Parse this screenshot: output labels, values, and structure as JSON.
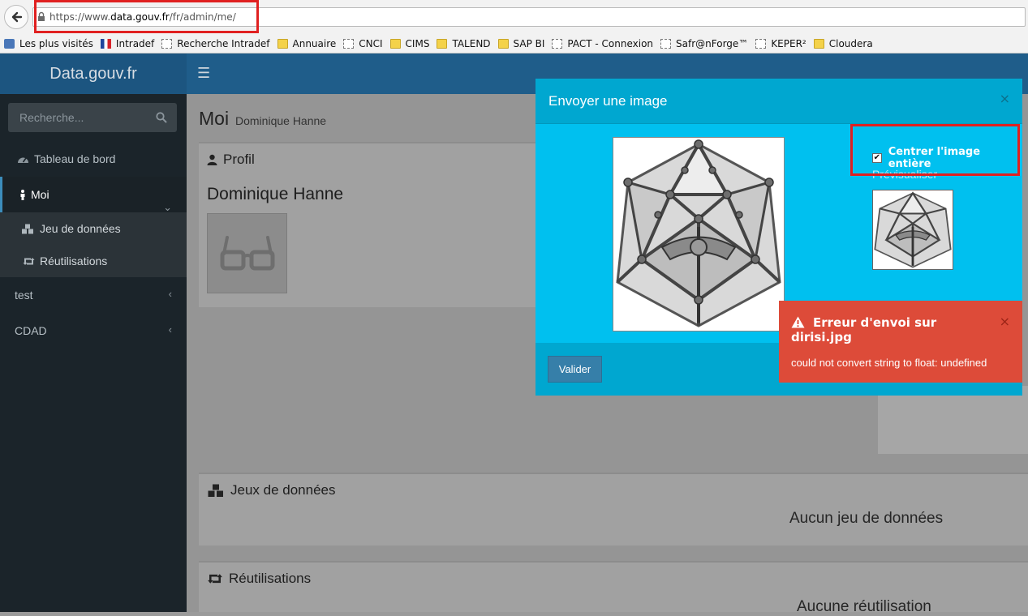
{
  "browser": {
    "url_prefix": "https://www.",
    "url_domain": "data.gouv.fr",
    "url_path": "/fr/admin/me/",
    "bookmarks": [
      {
        "label": "Les plus visités",
        "icon": "magnifier-icon"
      },
      {
        "label": "Intradef",
        "icon": "french-flag-icon"
      },
      {
        "label": "Recherche Intradef",
        "icon": "dashed-page-icon"
      },
      {
        "label": "Annuaire",
        "icon": "folder-icon"
      },
      {
        "label": "CNCI",
        "icon": "dashed-page-icon"
      },
      {
        "label": "CIMS",
        "icon": "folder-icon"
      },
      {
        "label": "TALEND",
        "icon": "folder-icon"
      },
      {
        "label": "SAP BI",
        "icon": "folder-icon"
      },
      {
        "label": "PACT - Connexion",
        "icon": "dashed-page-icon"
      },
      {
        "label": "Safr@nForge™",
        "icon": "dashed-page-icon"
      },
      {
        "label": "KEPER²",
        "icon": "dashed-page-icon"
      },
      {
        "label": "Cloudera",
        "icon": "folder-icon"
      }
    ]
  },
  "app": {
    "brand": "Data.gouv.fr",
    "search_placeholder": "Recherche...",
    "sidebar": {
      "dashboard": "Tableau de bord",
      "moi": "Moi",
      "datasets": "Jeu de données",
      "reuses": "Réutilisations",
      "test": "test",
      "cdad": "CDAD"
    },
    "page": {
      "title": "Moi",
      "subtitle": "Dominique Hanne",
      "profile_title": "Profil",
      "profile_name": "Dominique Hanne",
      "datasets_title": "Jeux de données",
      "datasets_empty": "Aucun jeu de données",
      "reuses_title": "Réutilisations",
      "reuses_empty": "Aucune réutilisation"
    }
  },
  "modal": {
    "title": "Envoyer une image",
    "close": "×",
    "center_label": "Centrer l'image entière",
    "center_checked": true,
    "preview_label": "Prévisualiser",
    "valider": "Valider"
  },
  "toast": {
    "title": "Erreur d'envoi sur dirisi.jpg",
    "message": "could not convert string to float: undefined",
    "close": "×"
  },
  "colors": {
    "modal_bg": "#00c0ef",
    "modal_header": "#00a7d0",
    "error": "#dd4b39",
    "highlight": "#e02020",
    "sidebar": "#1b242a"
  }
}
